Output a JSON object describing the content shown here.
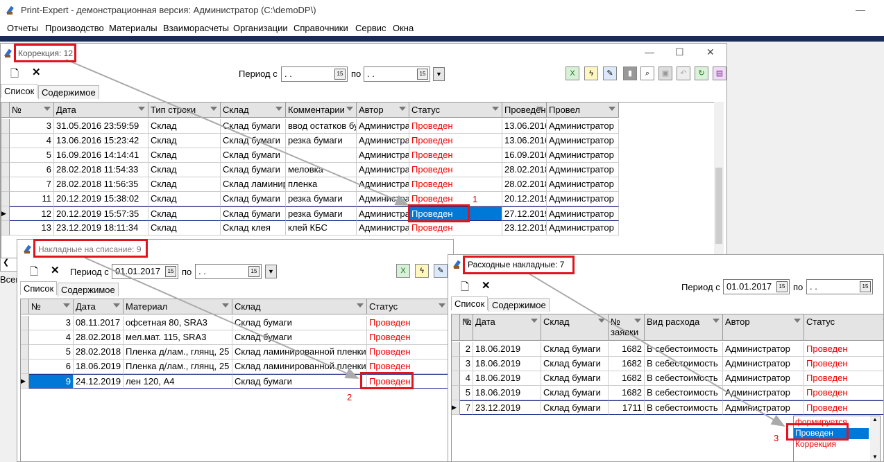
{
  "app": {
    "title": "Print-Expert - демонстрационная версия: Администратор (C:\\demoDP\\)",
    "menu": [
      "Отчеты",
      "Производство",
      "Материалы",
      "Взаиморасчеты",
      "Организации",
      "Справочники",
      "Сервис",
      "Окна"
    ]
  },
  "w1": {
    "title": "Коррекция: 12",
    "period_label": "Период с",
    "period_to": "по",
    "date_from": " .  .",
    "date_to": " .  .",
    "tabs": [
      "Список",
      "Содержимое"
    ],
    "columns": [
      "№",
      "Дата",
      "Тип строки",
      "Склад",
      "Комментарии",
      "Автор",
      "Статус",
      "Проведен",
      "Провел"
    ],
    "rows": [
      {
        "n": "3",
        "date": "31.05.2016 23:59:59",
        "type": "Склад",
        "wh": "Склад бумаги",
        "comment": "ввод остатков бу",
        "author": "Администра",
        "status": "Проведен",
        "done": "13.06.2016",
        "by": "Администратор"
      },
      {
        "n": "4",
        "date": "13.06.2016 15:23:42",
        "type": "Склад",
        "wh": "Склад бумаги",
        "comment": "резка бумаги",
        "author": "Администра",
        "status": "Проведен",
        "done": "13.06.2016",
        "by": "Администратор"
      },
      {
        "n": "5",
        "date": "16.09.2016 14:14:41",
        "type": "Склад",
        "wh": "Склад бумаги",
        "comment": "",
        "author": "Администра",
        "status": "Проведен",
        "done": "16.09.2016",
        "by": "Администратор"
      },
      {
        "n": "6",
        "date": "28.02.2018 11:54:33",
        "type": "Склад",
        "wh": "Склад бумаги",
        "comment": "меловка",
        "author": "Администра",
        "status": "Проведен",
        "done": "28.02.2018",
        "by": "Администратор"
      },
      {
        "n": "7",
        "date": "28.02.2018 11:56:35",
        "type": "Склад",
        "wh": "Склад ламинир",
        "comment": "пленка",
        "author": "Администра",
        "status": "Проведен",
        "done": "28.02.2018",
        "by": "Администратор"
      },
      {
        "n": "11",
        "date": "20.12.2019 15:38:02",
        "type": "Склад",
        "wh": "Склад бумаги",
        "comment": "резка бумаги",
        "author": "Администра",
        "status": "Проведен",
        "done": "20.12.2019",
        "by": "Администратор"
      },
      {
        "n": "12",
        "date": "20.12.2019 15:57:35",
        "type": "Склад",
        "wh": "Склад бумаги",
        "comment": "резка бумаги",
        "author": "Администра",
        "status": "Проведен",
        "done": "27.12.2019",
        "by": "Администратор"
      },
      {
        "n": "13",
        "date": "23.12.2019 18:11:34",
        "type": "Склад",
        "wh": "Склад клея",
        "comment": "клей КБС",
        "author": "Администра",
        "status": "Проведен",
        "done": "23.12.2019",
        "by": "Администратор"
      }
    ],
    "left_cut": "Всег"
  },
  "w2": {
    "title": "Накладные на списание: 9",
    "period_label": "Период с",
    "period_to": "по",
    "date_from": "01.01.2017",
    "date_to": " .  .",
    "tabs": [
      "Список",
      "Содержимое"
    ],
    "columns": [
      "№",
      "Дата",
      "Материал",
      "Склад",
      "Статус"
    ],
    "rows": [
      {
        "n": "3",
        "date": "08.11.2017",
        "mat": "офсетная 80, SRA3",
        "wh": "Склад бумаги",
        "status": "Проведен"
      },
      {
        "n": "4",
        "date": "28.02.2018",
        "mat": "мел.мат. 115, SRA3",
        "wh": "Склад бумаги",
        "status": "Проведен"
      },
      {
        "n": "5",
        "date": "28.02.2018",
        "mat": "Пленка д/лам., глянц, 25",
        "wh": "Склад ламинированной пленки",
        "status": "Проведен"
      },
      {
        "n": "6",
        "date": "18.06.2019",
        "mat": "Пленка д/лам., глянц, 25",
        "wh": "Склад ламинированной пленки",
        "status": "Проведен"
      },
      {
        "n": "9",
        "date": "24.12.2019",
        "mat": "лен 120, A4",
        "wh": "Склад бумаги",
        "status": "Проведен"
      }
    ]
  },
  "w3": {
    "title": "Расходные накладные: 7",
    "period_label": "Период с",
    "period_to": "по",
    "date_from": "01.01.2017",
    "date_to": " .  .",
    "tabs": [
      "Список",
      "Содержимое"
    ],
    "columns": [
      "№",
      "Дата",
      "Склад",
      "№ заявки",
      "Вид расхода",
      "Автор",
      "Статус"
    ],
    "rows": [
      {
        "n": "2",
        "date": "18.06.2019",
        "wh": "Склад бумаги",
        "req": "1682",
        "kind": "В себестоимость",
        "author": "Администратор",
        "status": "Проведен"
      },
      {
        "n": "3",
        "date": "18.06.2019",
        "wh": "Склад бумаги",
        "req": "1682",
        "kind": "В себестоимость",
        "author": "Администратор",
        "status": "Проведен"
      },
      {
        "n": "4",
        "date": "18.06.2019",
        "wh": "Склад бумаги",
        "req": "1682",
        "kind": "В себестоимость",
        "author": "Администратор",
        "status": "Проведен"
      },
      {
        "n": "5",
        "date": "18.06.2019",
        "wh": "Склад бумаги",
        "req": "1682",
        "kind": "В себестоимость",
        "author": "Администратор",
        "status": "Проведен"
      },
      {
        "n": "7",
        "date": "23.12.2019",
        "wh": "Склад бумаги",
        "req": "1711",
        "kind": "В себестоимость",
        "author": "Администратор",
        "status": "Проведен"
      }
    ],
    "dropdown": [
      "формируется",
      "Проведен",
      "Коррекция"
    ]
  },
  "annotations": [
    "1",
    "2",
    "3"
  ]
}
